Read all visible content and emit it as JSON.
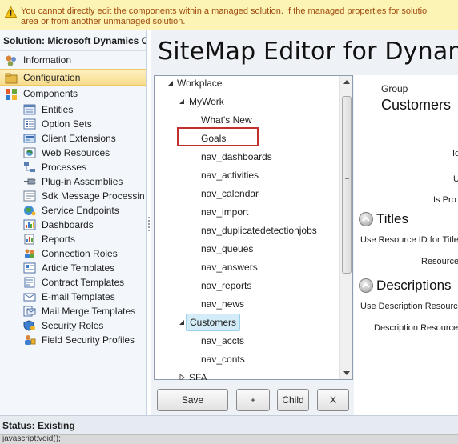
{
  "warning": {
    "line1": "You cannot directly edit the components within a managed solution. If the managed properties for solutio",
    "line2": "area or from another unmanaged solution."
  },
  "left_nav": {
    "solution_title": "Solution: Microsoft Dynamics C...",
    "items": [
      {
        "label": "Information",
        "icon": "information-icon"
      },
      {
        "label": "Configuration",
        "icon": "configuration-icon",
        "selected": true
      },
      {
        "label": "Components",
        "icon": "components-icon"
      }
    ],
    "components": [
      {
        "label": "Entities",
        "icon": "entities-icon"
      },
      {
        "label": "Option Sets",
        "icon": "option-sets-icon"
      },
      {
        "label": "Client Extensions",
        "icon": "client-extensions-icon"
      },
      {
        "label": "Web Resources",
        "icon": "web-resources-icon"
      },
      {
        "label": "Processes",
        "icon": "processes-icon"
      },
      {
        "label": "Plug-in Assemblies",
        "icon": "plug-in-assemblies-icon"
      },
      {
        "label": "Sdk Message Processin...",
        "icon": "sdk-message-processing-icon"
      },
      {
        "label": "Service Endpoints",
        "icon": "service-endpoints-icon"
      },
      {
        "label": "Dashboards",
        "icon": "dashboards-icon"
      },
      {
        "label": "Reports",
        "icon": "reports-icon"
      },
      {
        "label": "Connection Roles",
        "icon": "connection-roles-icon"
      },
      {
        "label": "Article Templates",
        "icon": "article-templates-icon"
      },
      {
        "label": "Contract Templates",
        "icon": "contract-templates-icon"
      },
      {
        "label": "E-mail Templates",
        "icon": "email-templates-icon"
      },
      {
        "label": "Mail Merge Templates",
        "icon": "mail-merge-templates-icon"
      },
      {
        "label": "Security Roles",
        "icon": "security-roles-icon"
      },
      {
        "label": "Field Security Profiles",
        "icon": "field-security-profiles-icon"
      }
    ]
  },
  "main": {
    "heading": "SiteMap Editor for Dynam"
  },
  "tree": {
    "nodes": [
      {
        "label": "Workplace",
        "expanded": true
      },
      {
        "label": "MyWork",
        "expanded": true
      },
      {
        "label": "What's New"
      },
      {
        "label": "Goals",
        "highlighted": true
      },
      {
        "label": "nav_dashboards"
      },
      {
        "label": "nav_activities"
      },
      {
        "label": "nav_calendar"
      },
      {
        "label": "nav_import"
      },
      {
        "label": "nav_duplicatedetectionjobs"
      },
      {
        "label": "nav_queues"
      },
      {
        "label": "nav_answers"
      },
      {
        "label": "nav_reports"
      },
      {
        "label": "nav_news"
      },
      {
        "label": "Customers",
        "expanded": true,
        "selected": true
      },
      {
        "label": "nav_accts"
      },
      {
        "label": "nav_conts"
      },
      {
        "label": "SFA",
        "expanded": false
      }
    ]
  },
  "buttons": {
    "save": "Save",
    "add": "+",
    "child": "Child",
    "remove": "X"
  },
  "details": {
    "group_label": "Group",
    "group_value": "Customers",
    "fields_top": [
      "Id",
      "U",
      "Is Pro"
    ],
    "titles_section": "Titles",
    "titles_fields": [
      "Use Resource ID for Title",
      "Resource"
    ],
    "descriptions_section": "Descriptions",
    "descriptions_fields": [
      "Use Description Resource",
      "Description Resource"
    ]
  },
  "status": {
    "text": "Status: Existing",
    "bottom": "javascript:void();"
  },
  "colors": {
    "warning_bg": "#fcf4b4",
    "warning_text": "#a04a10",
    "nav_bg": "#f3f7fc",
    "selected_bg": "#f8dc8c",
    "tree_selected_bg": "#d4ecf8",
    "highlight_border": "#c0302e"
  }
}
